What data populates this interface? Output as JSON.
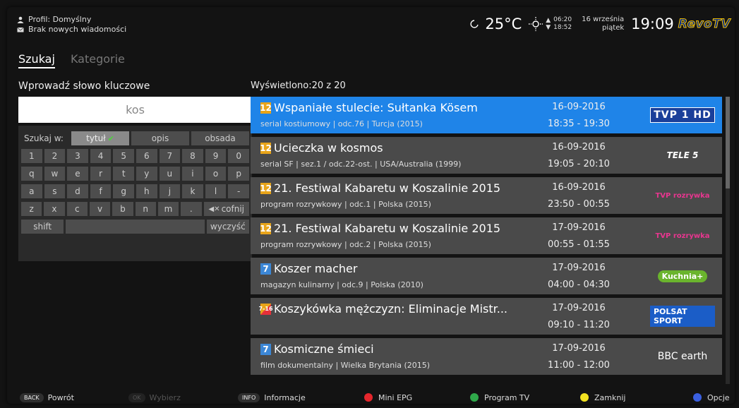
{
  "header": {
    "profile": "Profil: Domyślny",
    "messages": "Brak nowych wiadomości",
    "temperature": "25°C",
    "sunrise": "06:20",
    "sunset": "18:52",
    "date_line1": "16 września",
    "date_line2": "piątek",
    "clock": "19:09",
    "logo": "RevoTV"
  },
  "tabs": [
    {
      "label": "Szukaj"
    },
    {
      "label": "Kategorie"
    }
  ],
  "search": {
    "label": "Wprowadź słowo kluczowe",
    "value": "kos",
    "filter_label": "Szukaj w:",
    "filters": [
      "tytuł",
      "opis",
      "obsada"
    ],
    "rows": [
      [
        "1",
        "2",
        "3",
        "4",
        "5",
        "6",
        "7",
        "8",
        "9",
        "0"
      ],
      [
        "q",
        "w",
        "e",
        "r",
        "t",
        "y",
        "u",
        "i",
        "o",
        "p"
      ],
      [
        "a",
        "s",
        "d",
        "f",
        "g",
        "h",
        "j",
        "k",
        "l",
        "-"
      ],
      [
        "z",
        "x",
        "c",
        "v",
        "b",
        "n",
        "m",
        "."
      ]
    ],
    "backspace": "cofnij",
    "shift": "shift",
    "clear": "wyczyść"
  },
  "results": {
    "count": "Wyświetlono:20 z 20",
    "items": [
      {
        "age": "12",
        "title": "Wspaniałe stulecie: Sułtanka Kösem",
        "meta": "serial kostiumowy | odc.76 | Turcja (2015)",
        "date": "16-09-2016",
        "time": "18:35 - 19:30",
        "channel": "TVP 1 HD"
      },
      {
        "age": "12",
        "title": "Ucieczka w kosmos",
        "meta": "serial SF | sez.1 / odc.22-ost. | USA/Australia (1999)",
        "date": "16-09-2016",
        "time": "19:05 - 20:10",
        "channel": "TELE 5"
      },
      {
        "age": "12",
        "title": "21. Festiwal Kabaretu w Koszalinie 2015",
        "meta": "program rozrywkowy | odc.1 | Polska (2015)",
        "date": "16-09-2016",
        "time": "23:50 - 00:55",
        "channel": "TVP rozrywka"
      },
      {
        "age": "12",
        "title": "21. Festiwal Kabaretu w Koszalinie 2015",
        "meta": "program rozrywkowy | odc.2 | Polska (2015)",
        "date": "17-09-2016",
        "time": "00:55 - 01:55",
        "channel": "TVP rozrywka"
      },
      {
        "age": "7",
        "title": "Koszer macher",
        "meta": "magazyn kulinarny | odc.9 | Polska (2010)",
        "date": "17-09-2016",
        "time": "04:00 - 04:30",
        "channel": "Kuchnia+"
      },
      {
        "age": "7-16",
        "title": "Koszykówka mężczyzn: Eliminacje Mistr...",
        "meta": "",
        "date": "17-09-2016",
        "time": "09:10 - 11:20",
        "channel": "POLSAT SPORT"
      },
      {
        "age": "7",
        "title": "Kosmiczne śmieci",
        "meta": "film dokumentalny | Wielka Brytania (2015)",
        "date": "17-09-2016",
        "time": "11:00 - 12:00",
        "channel": "BBC earth"
      }
    ]
  },
  "footer": {
    "back_key": "BACK",
    "back": "Powrót",
    "ok_key": "OK",
    "ok": "Wybierz",
    "info_key": "INFO",
    "info": "Informacje",
    "red": "Mini EPG",
    "green": "Program TV",
    "yellow": "Zamknij",
    "blue": "Opcje"
  },
  "colors": {
    "selected": "#1f84e8",
    "red": "#e5262c",
    "green": "#2fa84a",
    "yellow": "#f2e221",
    "blue": "#3a5fe0"
  }
}
